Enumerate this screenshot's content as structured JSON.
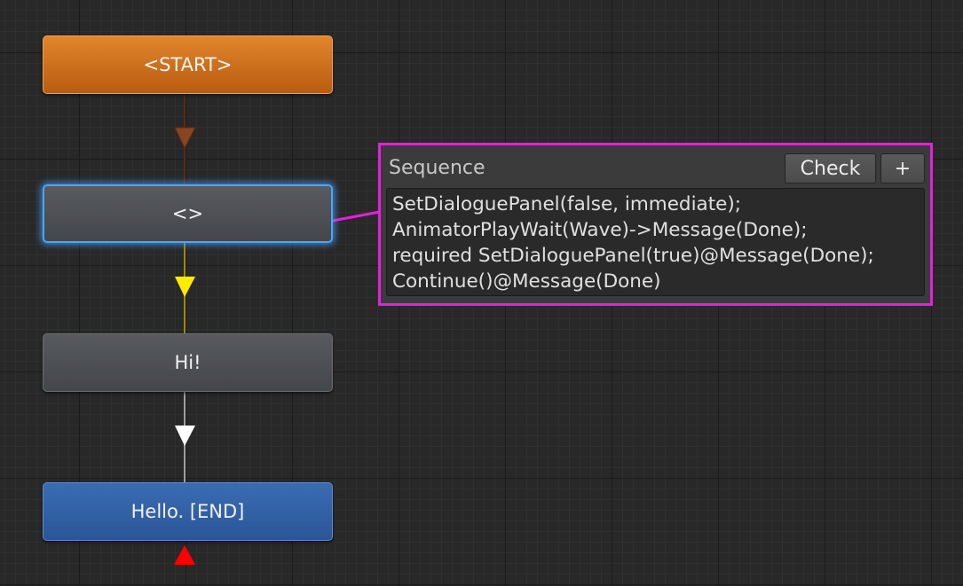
{
  "nodes": {
    "start": "<START>",
    "empty": "<>",
    "hi": "Hi!",
    "end": "Hello. [END]"
  },
  "panel": {
    "title": "Sequence",
    "check_label": "Check",
    "add_label": "+",
    "sequence_lines": [
      "SetDialoguePanel(false, immediate);",
      "AnimatorPlayWait(Wave)->Message(Done);",
      "required SetDialoguePanel(true)@Message(Done);",
      "Continue()@Message(Done)"
    ]
  },
  "colors": {
    "start_node": "#d4781e",
    "selected_node_glow": "#4aa6ff",
    "dialogue_node": "#4d5055",
    "end_node": "#3263a6",
    "highlight_annotation": "#e81ee0",
    "link_orange": "#7a3c16",
    "link_yellow": "#ffeb00",
    "link_white": "#ffffff",
    "link_red": "#ff0000",
    "connector_handle": "#0a24ff"
  },
  "icons": {
    "connector_handle": "right-triangle-handle",
    "link_arrows": "down-triangle-arrow",
    "annotation": "arrow-pointer"
  }
}
